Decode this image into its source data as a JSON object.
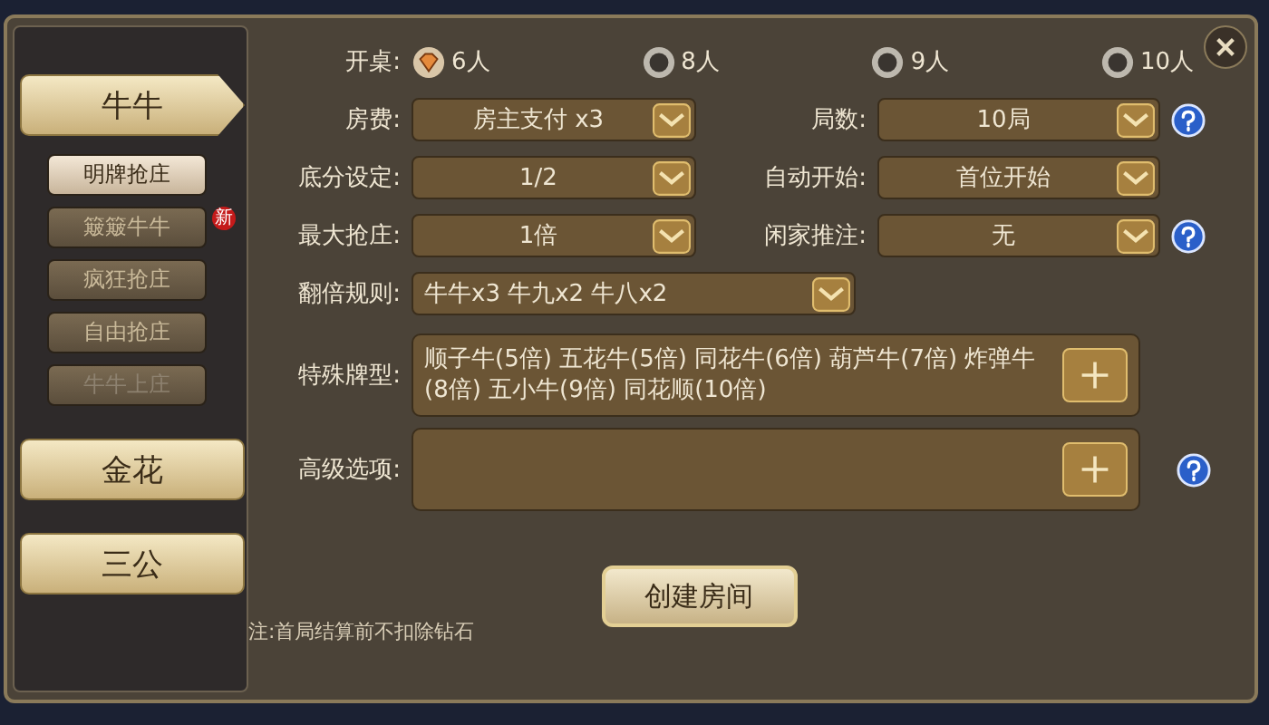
{
  "game_tabs": [
    {
      "label": "牛牛",
      "selected": true,
      "modes": [
        {
          "label": "明牌抢庄",
          "selected": true,
          "disabled": false
        },
        {
          "label": "簸簸牛牛",
          "selected": false,
          "disabled": false,
          "badge": "新"
        },
        {
          "label": "疯狂抢庄",
          "selected": false,
          "disabled": false
        },
        {
          "label": "自由抢庄",
          "selected": false,
          "disabled": false
        },
        {
          "label": "牛牛上庄",
          "selected": false,
          "disabled": true
        }
      ]
    },
    {
      "label": "金花",
      "selected": false
    },
    {
      "label": "三公",
      "selected": false
    }
  ],
  "table_size": {
    "label": "开桌:",
    "options": [
      {
        "label": "6人",
        "selected": true
      },
      {
        "label": "8人",
        "selected": false
      },
      {
        "label": "9人",
        "selected": false
      },
      {
        "label": "10人",
        "selected": false
      }
    ]
  },
  "dropdown_rows": [
    {
      "fields": [
        {
          "label": "房费:",
          "value": "房主支付 x3"
        },
        {
          "label": "局数:",
          "value": "10局"
        }
      ],
      "help": true
    },
    {
      "fields": [
        {
          "label": "底分设定:",
          "value": "1/2"
        },
        {
          "label": "自动开始:",
          "value": "首位开始"
        }
      ],
      "help": false
    },
    {
      "fields": [
        {
          "label": "最大抢庄:",
          "value": "1倍"
        },
        {
          "label": "闲家推注:",
          "value": "无"
        }
      ],
      "help": true
    }
  ],
  "double_rule": {
    "label": "翻倍规则:",
    "value": "牛牛x3 牛九x2 牛八x2"
  },
  "special_cards": {
    "label": "特殊牌型:",
    "value": "顺子牛(5倍) 五花牛(5倍) 同花牛(6倍) 葫芦牛(7倍) 炸弹牛(8倍) 五小牛(9倍) 同花顺(10倍)"
  },
  "advanced": {
    "label": "高级选项:",
    "help": true
  },
  "create_button": "创建房间",
  "note": "注:首局结算前不扣除钻石"
}
